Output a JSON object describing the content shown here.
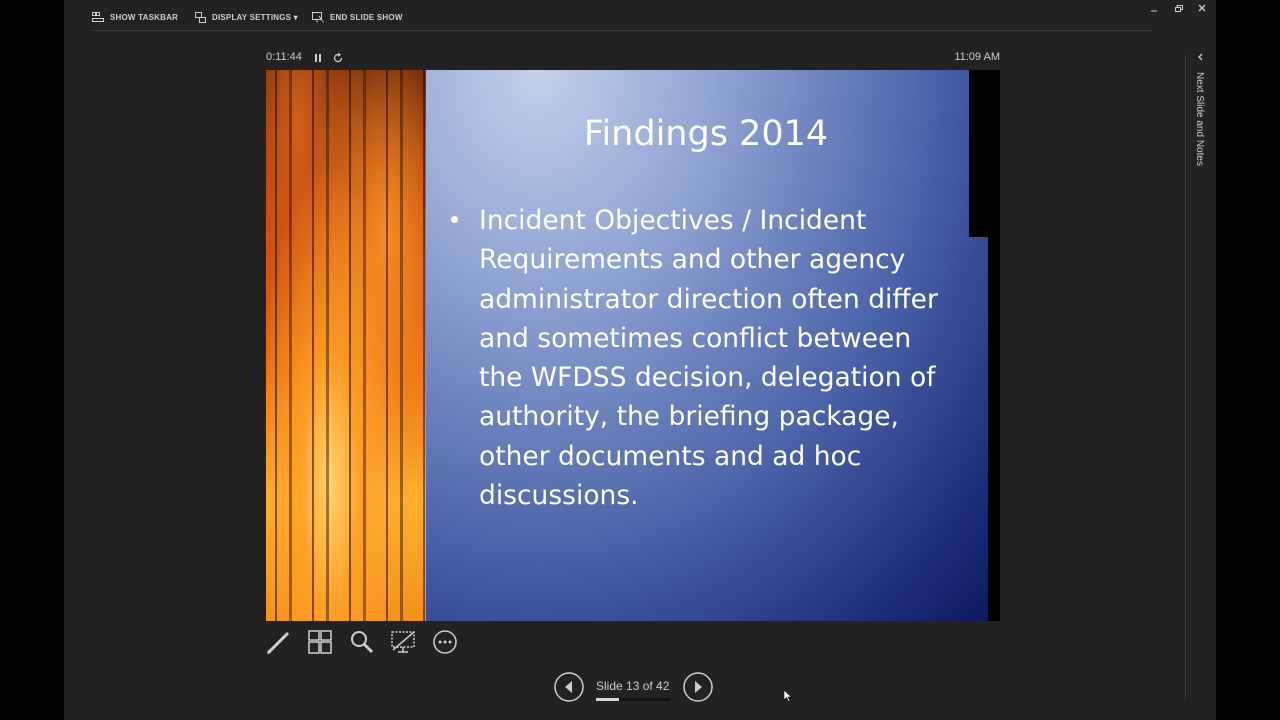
{
  "toolbar": {
    "show_taskbar_label": "SHOW TASKBAR",
    "display_settings_label": "DISPLAY SETTINGS ▾",
    "end_slide_show_label": "END SLIDE SHOW"
  },
  "window_controls": {
    "minimize_glyph": "–",
    "restore_glyph": "❐",
    "close_glyph": "✕"
  },
  "presenter": {
    "elapsed_time": "0:11:44",
    "clock": "11:09 AM"
  },
  "slide": {
    "title": "Findings 2014",
    "bullet_marker": "•",
    "bullet_text": "Incident Objectives / Incident Requirements and other agency administrator direction often differ and sometimes conflict between the WFDSS decision, delegation of authority, the briefing package, other documents and ad hoc discussions."
  },
  "tools": [
    "pen-tool-icon",
    "see-all-slides-icon",
    "zoom-icon",
    "black-screen-icon",
    "more-options-icon"
  ],
  "navigation": {
    "counter_text": "Slide 13 of 42",
    "current_slide": 13,
    "total_slides": 42
  },
  "notes_panel": {
    "toggle_label": "Next Slide and Notes"
  },
  "colors": {
    "stage_background": "#222222",
    "text": "#cfcfcf",
    "slide_blue": "#1d2c78"
  }
}
